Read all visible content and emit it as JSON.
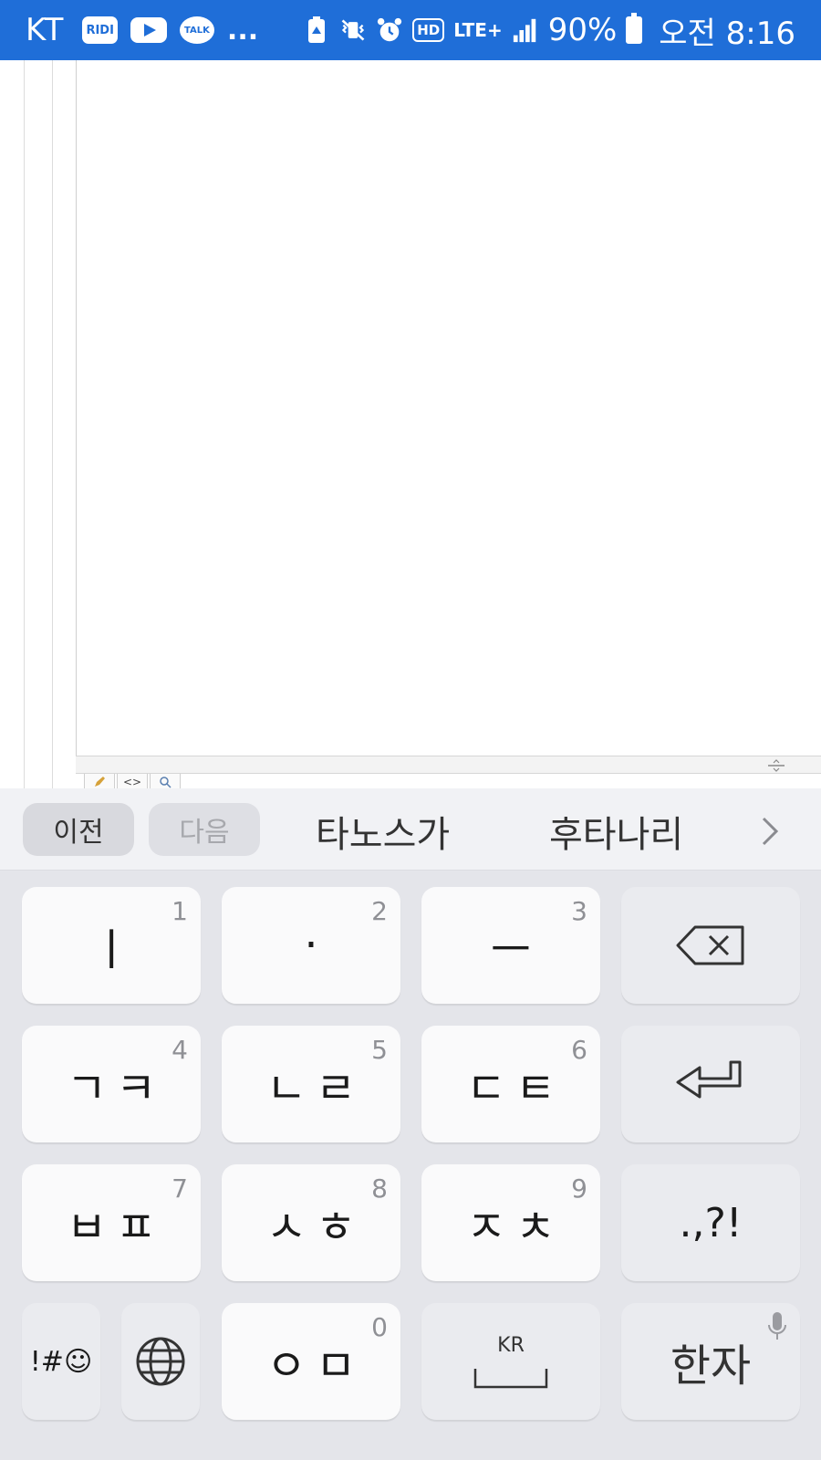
{
  "status_bar": {
    "carrier": "KT",
    "notification_icons": {
      "ridi": "RIDI",
      "youtube": "youtube-icon",
      "talk": "TALK",
      "more": "..."
    },
    "indicators": {
      "hd": "HD",
      "network": "LTE+"
    },
    "battery_percent": "90%",
    "time": "오전 8:16"
  },
  "editor": {
    "mode_tabs": [
      "pencil-icon",
      "<>",
      "magnifier-icon"
    ],
    "resize_handle_icon": "resize-handle-icon"
  },
  "keyboard": {
    "suggestion_bar": {
      "prev_label": "이전",
      "next_label": "다음",
      "suggestions": [
        "타노스가",
        "후타나리"
      ],
      "more_icon": "chevron-right-icon"
    },
    "rows": [
      [
        {
          "label": "ㅣ",
          "num": "1"
        },
        {
          "label": "·",
          "num": "2"
        },
        {
          "label": "ㅡ",
          "num": "3"
        },
        {
          "label": "backspace-icon",
          "num": ""
        }
      ],
      [
        {
          "label": "ㄱㅋ",
          "num": "4"
        },
        {
          "label": "ㄴㄹ",
          "num": "5"
        },
        {
          "label": "ㄷㅌ",
          "num": "6"
        },
        {
          "label": "enter-icon",
          "num": ""
        }
      ],
      [
        {
          "label": "ㅂㅍ",
          "num": "7"
        },
        {
          "label": "ㅅㅎ",
          "num": "8"
        },
        {
          "label": "ㅈㅊ",
          "num": "9"
        },
        {
          "label": ".,?!",
          "num": ""
        }
      ]
    ],
    "bottom_row": {
      "symbols_label": "!#☺",
      "globe_icon": "globe-icon",
      "om_key": {
        "label": "ㅇㅁ",
        "num": "0"
      },
      "space_label": "KR",
      "hanja_label": "한자",
      "mic_icon": "microphone-icon"
    },
    "colors": {
      "status_bar": "#1f6ed8",
      "keyboard_bg": "#e4e5ea",
      "key_bg": "#fafafb",
      "func_key_bg": "#eaebef"
    }
  }
}
